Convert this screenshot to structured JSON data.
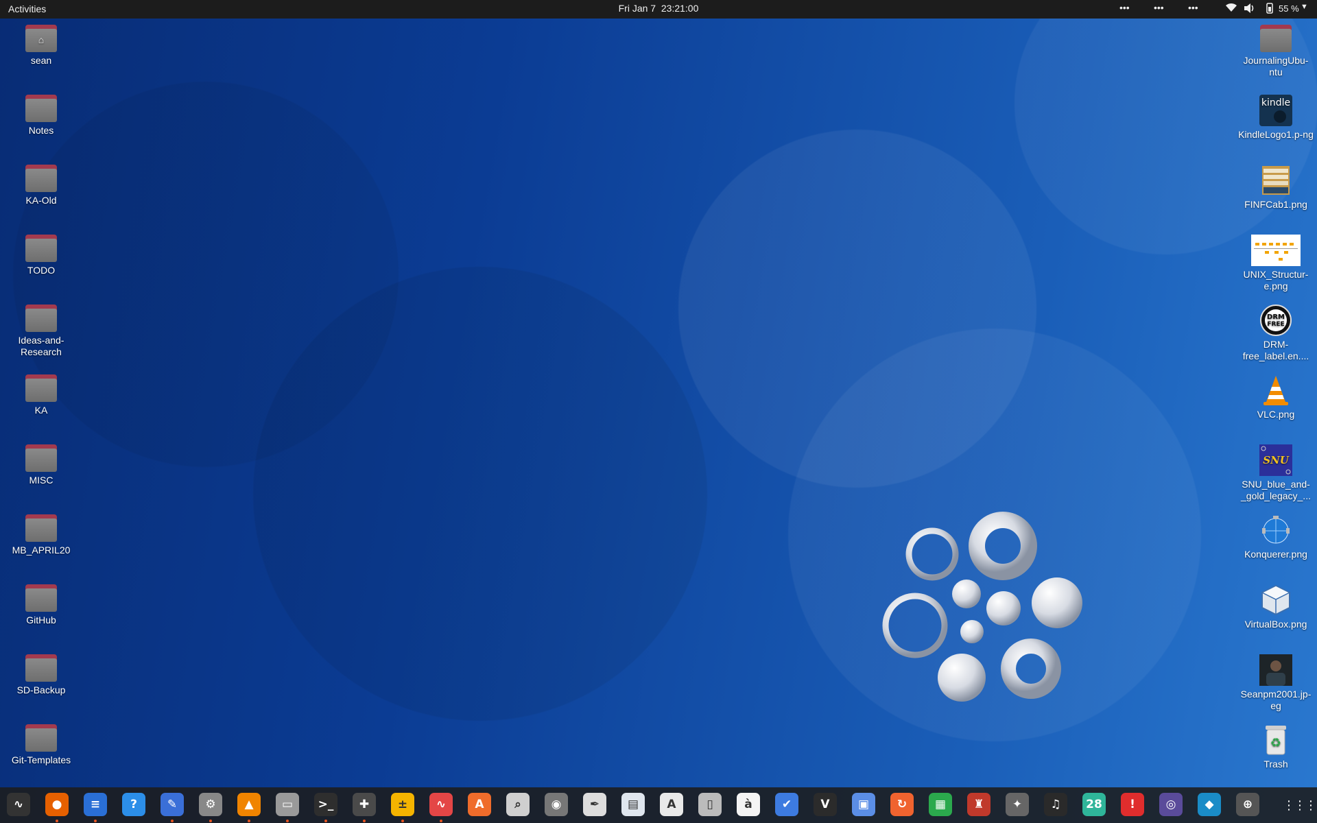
{
  "topbar": {
    "activities": "Activities",
    "date": "Fri Jan 7",
    "time": "23:21:00",
    "indicators": [
      "•••",
      "•••",
      "•••"
    ],
    "battery": "55 %"
  },
  "desktop_left": [
    {
      "label": "sean",
      "icon": "home-folder-icon"
    },
    {
      "label": "Notes",
      "icon": "folder-icon"
    },
    {
      "label": "KA-Old",
      "icon": "folder-icon"
    },
    {
      "label": "TODO",
      "icon": "folder-icon"
    },
    {
      "label": "Ideas-and-Research",
      "icon": "folder-icon"
    },
    {
      "label": "KA",
      "icon": "folder-icon"
    },
    {
      "label": "MISC",
      "icon": "folder-icon"
    },
    {
      "label": "MB_APRIL20",
      "icon": "folder-icon"
    },
    {
      "label": "GitHub",
      "icon": "folder-icon"
    },
    {
      "label": "SD-Backup",
      "icon": "folder-icon"
    },
    {
      "label": "Git-Templates",
      "icon": "folder-icon"
    }
  ],
  "desktop_right": [
    {
      "label": "JournalingUbuntu",
      "display": "JournalingUbu-ntu",
      "icon": "folder-icon"
    },
    {
      "label": "KindleLogo1.png",
      "display": "KindleLogo1.p-ng",
      "icon": "kindle-image-icon",
      "badge": "kindle"
    },
    {
      "label": "FINFCab1.png",
      "display": "FINFCab1.png",
      "icon": "cabinet-image-icon"
    },
    {
      "label": "UNIX_Structure.png",
      "display": "UNIX_Structur-e.png",
      "icon": "diagram-image-icon"
    },
    {
      "label": "DRM-free_label.en....",
      "display": "DRM-free_label.en....",
      "icon": "drm-free-image-icon",
      "badge": "DRM FREE"
    },
    {
      "label": "VLC.png",
      "display": "VLC.png",
      "icon": "vlc-cone-icon"
    },
    {
      "label": "SNU_blue_and_gold_legacy_...",
      "display": "SNU_blue_and-_gold_legacy_...",
      "icon": "snu-logo-image-icon",
      "badge": "SNU"
    },
    {
      "label": "Konquerer.png",
      "display": "Konquerer.png",
      "icon": "konqueror-globe-icon"
    },
    {
      "label": "VirtualBox.png",
      "display": "VirtualBox.png",
      "icon": "virtualbox-cube-icon"
    },
    {
      "label": "Seanpm2001.jpeg",
      "display": "Seanpm2001.jp-eg",
      "icon": "photo-image-icon"
    },
    {
      "label": "Trash",
      "display": "Trash",
      "icon": "trash-icon"
    }
  ],
  "dock": {
    "apps": [
      {
        "name": "system-monitor",
        "color": "#333333",
        "glyph": "∿",
        "running": false
      },
      {
        "name": "firefox",
        "color": "#e66000",
        "glyph": "●",
        "running": true
      },
      {
        "name": "libreoffice-writer",
        "color": "#2a6fd6",
        "glyph": "≡",
        "running": true
      },
      {
        "name": "help",
        "color": "#2c8ee8",
        "glyph": "?",
        "running": false
      },
      {
        "name": "text-editor",
        "color": "#3a6fd8",
        "glyph": "✎",
        "running": true
      },
      {
        "name": "settings",
        "color": "#888888",
        "glyph": "⚙",
        "running": true
      },
      {
        "name": "vlc",
        "color": "#f08400",
        "glyph": "▲",
        "running": true
      },
      {
        "name": "files",
        "color": "#9a9a9a",
        "glyph": "▭",
        "running": true
      },
      {
        "name": "terminal",
        "color": "#2e2e2e",
        "glyph": ">_",
        "running": true
      },
      {
        "name": "extensions",
        "color": "#4a4a4a",
        "glyph": "✚",
        "running": true
      },
      {
        "name": "calculator",
        "color": "#f5b400",
        "glyph": "±",
        "running": true
      },
      {
        "name": "charts",
        "color": "#e44646",
        "glyph": "∿",
        "running": true
      },
      {
        "name": "software-center",
        "color": "#ef6c2b",
        "glyph": "A",
        "running": false
      },
      {
        "name": "image-viewer",
        "color": "#cfcfcf",
        "glyph": "⌕",
        "running": false
      },
      {
        "name": "disks",
        "color": "#777777",
        "glyph": "◉",
        "running": false
      },
      {
        "name": "inkscape",
        "color": "#dddddd",
        "glyph": "✒",
        "running": false
      },
      {
        "name": "news-reader",
        "color": "#dfe6ee",
        "glyph": "▤",
        "running": false
      },
      {
        "name": "document-viewer",
        "color": "#e9e9e9",
        "glyph": "A",
        "running": false
      },
      {
        "name": "archive-manager",
        "color": "#bbbbbb",
        "glyph": "▯",
        "running": false
      },
      {
        "name": "character-map",
        "color": "#f4f4f4",
        "glyph": "à",
        "running": false
      },
      {
        "name": "todo",
        "color": "#3d7be0",
        "glyph": "✔",
        "running": false
      },
      {
        "name": "vim",
        "color": "#2b2b2b",
        "glyph": "V",
        "running": false
      },
      {
        "name": "remote-desktop",
        "color": "#5b8ee6",
        "glyph": "▣",
        "running": false
      },
      {
        "name": "software-updater",
        "color": "#f0632f",
        "glyph": "↻",
        "running": false
      },
      {
        "name": "spreadsheet",
        "color": "#2ba94d",
        "glyph": "▦",
        "running": false
      },
      {
        "name": "game",
        "color": "#c0392b",
        "glyph": "♜",
        "running": false
      },
      {
        "name": "gimp",
        "color": "#666666",
        "glyph": "✦",
        "running": false
      },
      {
        "name": "music",
        "color": "#2a2a2a",
        "glyph": "♫",
        "running": false
      },
      {
        "name": "calendar",
        "color": "#2fb59a",
        "glyph": "28",
        "running": false
      },
      {
        "name": "error-reporter",
        "color": "#e02d2d",
        "glyph": "!",
        "running": false
      },
      {
        "name": "screenshot",
        "color": "#5a4b9a",
        "glyph": "◎",
        "running": false
      },
      {
        "name": "weather-app",
        "color": "#1a8cc7",
        "glyph": "◆",
        "running": false
      },
      {
        "name": "ubuntu-one",
        "color": "#555555",
        "glyph": "⊕",
        "running": false
      }
    ],
    "show_apps_label": "⋮⋮⋮"
  }
}
